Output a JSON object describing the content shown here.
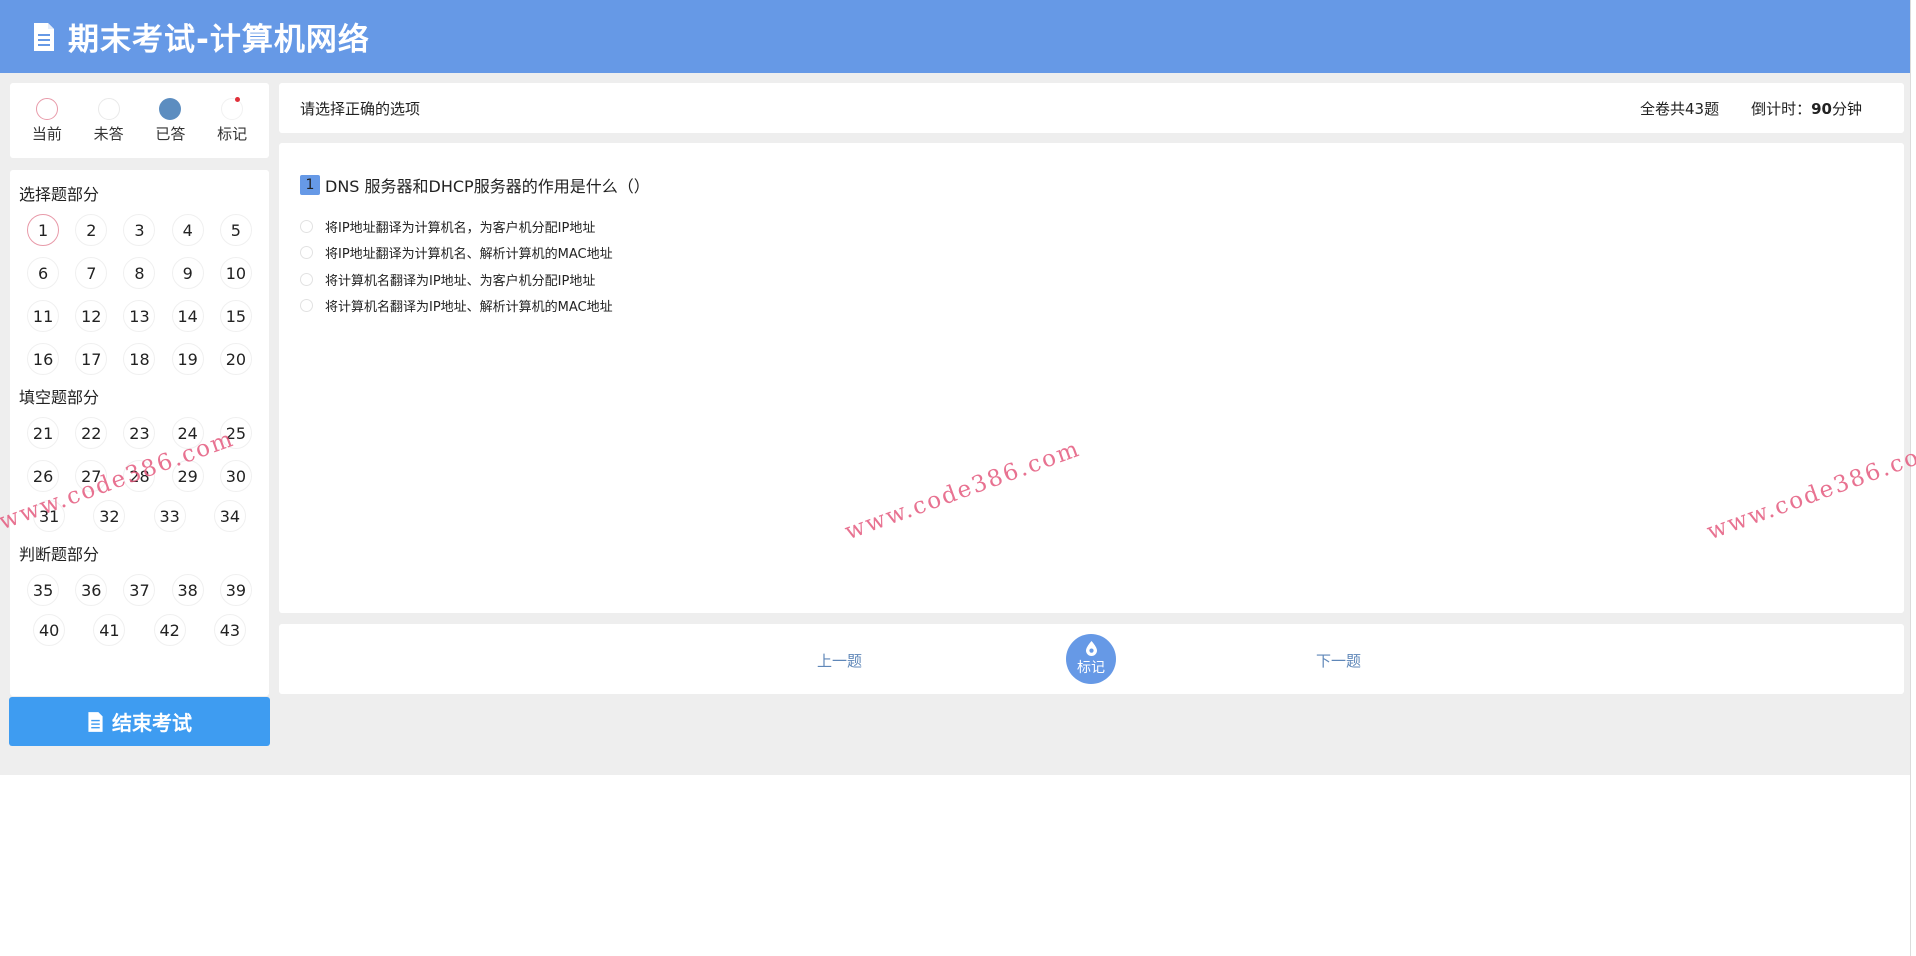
{
  "header": {
    "title": "期末考试-计算机网络",
    "icon": "document-icon"
  },
  "legend": [
    {
      "label": "当前",
      "state": "current"
    },
    {
      "label": "未答",
      "state": "unanswered"
    },
    {
      "label": "已答",
      "state": "answered"
    },
    {
      "label": "标记",
      "state": "marked"
    }
  ],
  "sections": [
    {
      "title": "选择题部分",
      "numbers": [
        "1",
        "2",
        "3",
        "4",
        "5",
        "6",
        "7",
        "8",
        "9",
        "10",
        "11",
        "12",
        "13",
        "14",
        "15",
        "16",
        "17",
        "18",
        "19",
        "20"
      ]
    },
    {
      "title": "填空题部分",
      "numbers": [
        "21",
        "22",
        "23",
        "24",
        "25",
        "26",
        "27",
        "28",
        "29",
        "30",
        "31",
        "32",
        "33",
        "34"
      ]
    },
    {
      "title": "判断题部分",
      "numbers": [
        "35",
        "36",
        "37",
        "38",
        "39",
        "40",
        "41",
        "42",
        "43"
      ]
    }
  ],
  "current_question": "1",
  "end_button": {
    "label": "结束考试",
    "icon": "document-icon"
  },
  "infobar": {
    "instruction": "请选择正确的选项",
    "total": "全卷共43题",
    "countdown_label": "倒计时：",
    "countdown_value": "90",
    "countdown_unit": "分钟"
  },
  "question": {
    "number": "1",
    "stem": "DNS 服务器和DHCP服务器的作用是什么（）",
    "options": [
      "将IP地址翻译为计算机名，为客户机分配IP地址",
      "将IP地址翻译为计算机名、解析计算机的MAC地址",
      "将计算机名翻译为IP地址、为客户机分配IP地址",
      "将计算机名翻译为IP地址、解析计算机的MAC地址"
    ]
  },
  "actions": {
    "prev": "上一题",
    "mark": "标记",
    "next": "下一题",
    "mark_icon": "drop-icon"
  },
  "watermark": "www.code386.com",
  "colors": {
    "header": "#6699e6",
    "end_button": "#3e9cf1",
    "answered": "#5c8dc0",
    "current_border": "#e89aa9",
    "watermark": "#e45a7e"
  }
}
